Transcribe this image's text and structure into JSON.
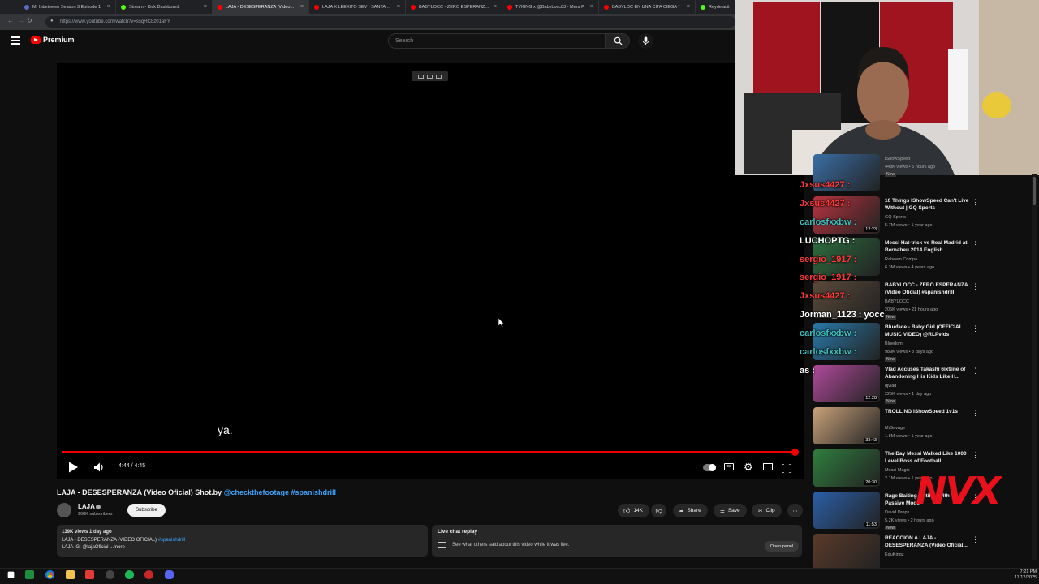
{
  "browser": {
    "tabs": [
      {
        "label": "Mr Inbetween Season 3 Episode 1",
        "color": "#5c6bc0"
      },
      {
        "label": "Stream - Kick Dashboard",
        "color": "#53fc18"
      },
      {
        "label": "LAJA - DESESPERANZA (Video Ofi",
        "color": "#ff0000"
      },
      {
        "label": "LAJA X LEEXITO SEV - SANTA GLO",
        "color": "#ff0000"
      },
      {
        "label": "BABYLOCC - ZERO ESPERANZA (V",
        "color": "#ff0000"
      },
      {
        "label": "TYKING x @BabyLocc83 - Mera P",
        "color": "#ff0000"
      },
      {
        "label": "BABYLOC EN UNA CITA CIEGA *",
        "color": "#ff0000"
      },
      {
        "label": "Reydelacit",
        "color": "#53fc18"
      }
    ],
    "url": "https://www.youtube.com/watch?v=ssqHC8z01aFY"
  },
  "header": {
    "brand": "Premium",
    "search_placeholder": "Search"
  },
  "player": {
    "caption": "ya.",
    "time": "4:44 / 4:45",
    "progress": 0.996
  },
  "video": {
    "title_main": "LAJA - DESESPERANZA (Video Oficial) Shot.by ",
    "title_links": "@checkthefootage #spanishdrill",
    "channel": "LAJA",
    "subscribers": "268K subscribers",
    "subscribe_label": "Subscribe",
    "likes": "14K",
    "share_label": "Share",
    "save_label": "Save",
    "clip_label": "Clip",
    "desc_meta": "139K views  1 day ago",
    "desc_line1": "LAJA - DESESPERANZA (VIDEO OFICIAL) ",
    "desc_line1_tag": "#spanishdrill",
    "desc_line2": "LAJA IG: @lajaOficial",
    "desc_more": "...more"
  },
  "chat_replay": {
    "title": "Live chat replay",
    "subtitle": "See what others said about this video while it was live.",
    "button": "Open panel"
  },
  "recommendations": [
    {
      "title": "",
      "channel": "IShowSpeed",
      "meta": "448K views • 5 hours ago",
      "new": "New",
      "duration": ""
    },
    {
      "title": "10 Things IShowSpeed Can't Live Without | GQ Sports",
      "channel": "GQ Sports",
      "meta": "5.7M views • 1 year ago",
      "new": "",
      "duration": "12:23"
    },
    {
      "title": "Messi Hat-trick vs Real Madrid at Bernabeu 2014 English ...",
      "channel": "Raheem Compa",
      "meta": "6.3M views • 4 years ago",
      "new": "",
      "duration": ""
    },
    {
      "title": "BABYLOCC - ZERO ESPERANZA (Video Oficial) #spanishdrill",
      "channel": "BABYLOCC",
      "meta": "205K views • 21 hours ago",
      "new": "New",
      "duration": ""
    },
    {
      "title": "Blueface - Baby Girl (OFFICIAL MUSIC VIDEO) @RLPvids",
      "channel": "Bluedom",
      "meta": "989K views • 3 days ago",
      "new": "New",
      "duration": ""
    },
    {
      "title": "Vlad Accuses Takashi 6ix9ine of Abandoning His Kids Like H...",
      "channel": "djvlad",
      "meta": "225K views • 1 day ago",
      "new": "New",
      "duration": "12:28"
    },
    {
      "title": "TROLLING IShowSpeed 1v1s",
      "channel": "MrSavage",
      "meta": "1.8M views • 1 year ago",
      "new": "",
      "duration": "33:43"
    },
    {
      "title": "The Day Messi Walked Like 1000 Level Boss of Football",
      "channel": "Messi Magic",
      "meta": "2.1M views • 1 year ago",
      "new": "",
      "duration": "20:30"
    },
    {
      "title": "Rage Baiting Britih... With Passive Mode",
      "channel": "David Drops",
      "meta": "5.2K views • 2 hours ago",
      "new": "New",
      "duration": "11:53"
    },
    {
      "title": "REACCION A LAJA - DESESPERANZA (Video Oficial...",
      "channel": "EduKingz",
      "meta": "",
      "new": "",
      "duration": ""
    }
  ],
  "overlay_chat": [
    {
      "name": "Jxsus4427 :",
      "color": "#ff3b3b"
    },
    {
      "name": "Jxsus4427 :",
      "color": "#ff3b3b"
    },
    {
      "name": "carlosfxxbw :",
      "color": "#3fbfbf"
    },
    {
      "name": "LUCHOPTG :",
      "color": "#ffffff"
    },
    {
      "name": "sergio_1917 :",
      "color": "#ff3b3b"
    },
    {
      "name": "sergio_1917 :",
      "color": "#ff3b3b"
    },
    {
      "name": "Jxsus4427 :",
      "color": "#ff3b3b"
    },
    {
      "name": "Jorman_1123 : yocc",
      "color": "#ffffff"
    },
    {
      "name": "carlosfxxbw :",
      "color": "#3fbfbf"
    },
    {
      "name": "carlosfxxbw :",
      "color": "#3fbfbf"
    },
    {
      "name": "as :",
      "color": "#ffffff"
    }
  ],
  "watermark": "NVX",
  "clock": {
    "time": "7:21 PM",
    "date": "11/12/2025"
  }
}
